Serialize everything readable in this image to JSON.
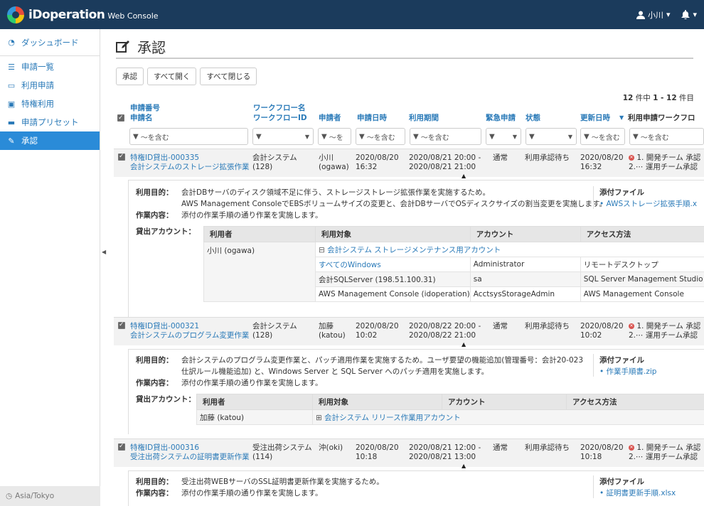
{
  "app": {
    "brand": "iDoperation",
    "brand_sub": "Web Console",
    "user": "小川",
    "user_caret": "▾",
    "bell_caret": "▾"
  },
  "sidebar": {
    "items": [
      {
        "label": "ダッシュボード",
        "icon": "dashboard-icon"
      },
      {
        "label": "申請一覧",
        "icon": "list-icon"
      },
      {
        "label": "利用申請",
        "icon": "inbox-icon"
      },
      {
        "label": "特権利用",
        "icon": "laptop-icon"
      },
      {
        "label": "申請プリセット",
        "icon": "preset-icon"
      },
      {
        "label": "承認",
        "icon": "edit-icon"
      }
    ],
    "timezone": "Asia/Tokyo"
  },
  "page": {
    "title": "承認"
  },
  "toolbar": {
    "approve": "承認",
    "expand_all": "すべて開く",
    "collapse_all": "すべて閉じる"
  },
  "count": {
    "total": "12",
    "unit": "件中",
    "range": "1 - 12",
    "suffix": "件目"
  },
  "columns": {
    "req_no": "申請番号",
    "req_name": "申請名",
    "wf_name": "ワークフロー名",
    "wf_id": "ワークフローID",
    "applicant": "申請者",
    "apply_date": "申請日時",
    "period": "利用期間",
    "urgent": "緊急申請",
    "status": "状態",
    "updated": "更新日時",
    "wf_cut": "利用申請ワークフロ"
  },
  "filters": {
    "contains": "〜を含む",
    "contains_short": "〜を"
  },
  "records": [
    {
      "no": "特権ID貸出-000335",
      "name": "会計システムのストレージ拡張作業",
      "wf": "会計システム",
      "wf_id": "(128)",
      "applicant": "小川",
      "applicant_id": "(ogawa)",
      "apply_date": "2020/08/20",
      "apply_time": "16:32",
      "period1": "2020/08/21 20:00 -",
      "period2": "2020/08/21 21:00",
      "urgent": "通常",
      "status": "利用承認待ち",
      "upd_date": "2020/08/20",
      "upd_time": "16:32",
      "wf1": "1. 開発チーム 承認",
      "wf2": "2.⋯ 運用チーム承認",
      "purpose_label": "利用目的：",
      "purpose1": "会計DBサーバのディスク領域不足に伴う、ストレージストレージ拡張作業を実施するため。",
      "purpose2": "AWS Management ConsoleでEBSボリュームサイズの変更と、会計DBサーバでOSディスクサイズの割当変更を実施します。",
      "work_label": "作業内容：",
      "work": "添付の作業手順の通り作業を実施します。",
      "attach_title": "添付ファイル",
      "attach": "AWSストレージ拡張手順.x",
      "acc_label": "貸出アカウント：",
      "th_user": "利用者",
      "th_target": "利用対象",
      "th_account": "アカウント",
      "th_method": "アクセス方法",
      "user": "小川 (ogawa)",
      "group": "会計システム ストレージメンテナンス用アカウント",
      "rows": [
        {
          "target": "すべてのWindows",
          "account": "Administrator",
          "method": "リモートデスクトップ"
        },
        {
          "target": "会計SQLServer (198.51.100.31)",
          "account": "sa",
          "method": "SQL Server Management Studio"
        },
        {
          "target": "AWS Management Console (idoperation)",
          "account": "AcctsysStorageAdmin",
          "method": "AWS Management Console"
        }
      ]
    },
    {
      "no": "特権ID貸出-000321",
      "name": "会計システムのプログラム変更作業",
      "wf": "会計システム",
      "wf_id": "(128)",
      "applicant": "加藤",
      "applicant_id": "(katou)",
      "apply_date": "2020/08/20",
      "apply_time": "10:02",
      "period1": "2020/08/22 20:00 -",
      "period2": "2020/08/22 21:00",
      "urgent": "通常",
      "status": "利用承認待ち",
      "upd_date": "2020/08/20",
      "upd_time": "10:02",
      "wf1": "1. 開発チーム 承認",
      "wf2": "2.⋯ 運用チーム承認",
      "purpose_label": "利用目的：",
      "purpose1": "会計システムのプログラム変更作業と、パッチ適用作業を実施するため。ユーザ要望の機能追加(管理番号：会計20-023",
      "purpose2": "仕訳ルール機能追加) と、Windows Server と SQL Server へのパッチ適用を実施します。",
      "work_label": "作業内容：",
      "work": "添付の作業手順の通り作業を実施します。",
      "attach_title": "添付ファイル",
      "attach": "作業手順書.zip",
      "acc_label": "貸出アカウント：",
      "th_user": "利用者",
      "th_target": "利用対象",
      "th_account": "アカウント",
      "th_method": "アクセス方法",
      "user": "加藤 (katou)",
      "group": "会計システム リリース作業用アカウント"
    },
    {
      "no": "特権ID貸出-000316",
      "name": "受注出荷システムの証明書更新作業",
      "wf": "受注出荷システム",
      "wf_id": "(114)",
      "applicant": "沖(oki)",
      "apply_date": "2020/08/20",
      "apply_time": "10:18",
      "period1": "2020/08/21 12:00 -",
      "period2": "2020/08/21 13:00",
      "urgent": "通常",
      "status": "利用承認待ち",
      "upd_date": "2020/08/20",
      "upd_time": "10:18",
      "wf1": "1. 開発チーム 承認",
      "wf2": "2.⋯ 運用チーム承認",
      "purpose_label": "利用目的：",
      "purpose1": "受注出荷WEBサーバのSSL証明書更新作業を実施するため。",
      "work_label": "作業内容：",
      "work": "添付の作業手順の通り作業を実施します。",
      "attach_title": "添付ファイル",
      "attach": "証明書更新手順.xlsx"
    }
  ]
}
